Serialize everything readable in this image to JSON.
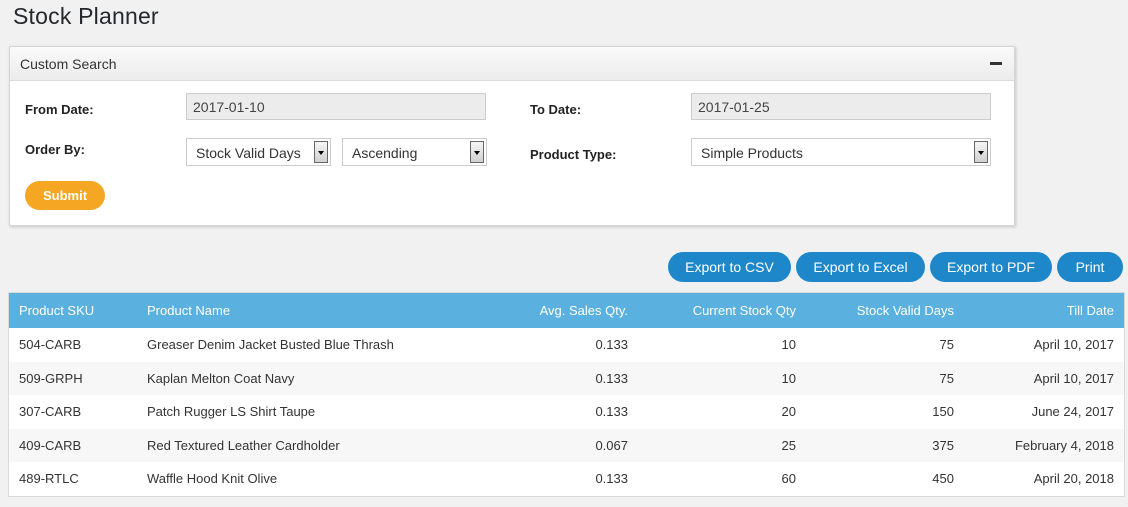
{
  "page": {
    "title": "Stock Planner"
  },
  "search": {
    "panel_title": "Custom Search",
    "from_date_label": "From Date:",
    "from_date_value": "2017-01-10",
    "to_date_label": "To Date:",
    "to_date_value": "2017-01-25",
    "order_by_label": "Order By:",
    "order_by_value": "Stock Valid Days",
    "order_direction_value": "Ascending",
    "product_type_label": "Product Type:",
    "product_type_value": "Simple Products",
    "submit_label": "Submit"
  },
  "actions": {
    "export_csv": "Export to CSV",
    "export_excel": "Export to Excel",
    "export_pdf": "Export to PDF",
    "print": "Print"
  },
  "table": {
    "headers": [
      "Product SKU",
      "Product Name",
      "Avg. Sales Qty.",
      "Current Stock Qty",
      "Stock Valid Days",
      "Till Date"
    ],
    "rows": [
      [
        "504-CARB",
        "Greaser Denim Jacket Busted Blue Thrash",
        "0.133",
        "10",
        "75",
        "April 10, 2017"
      ],
      [
        "509-GRPH",
        "Kaplan Melton Coat Navy",
        "0.133",
        "10",
        "75",
        "April 10, 2017"
      ],
      [
        "307-CARB",
        "Patch Rugger LS Shirt Taupe",
        "0.133",
        "20",
        "150",
        "June 24, 2017"
      ],
      [
        "409-CARB",
        "Red Textured Leather Cardholder",
        "0.067",
        "25",
        "375",
        "February 4, 2018"
      ],
      [
        "489-RTLC",
        "Waffle Hood Knit Olive",
        "0.133",
        "60",
        "450",
        "April 20, 2018"
      ]
    ]
  },
  "colors": {
    "submit": "#f5a623",
    "buttons": "#1e87c9",
    "table_header": "#5ab0de"
  },
  "icons": {
    "collapse": "minus-icon",
    "dropdown": "chevron-down-icon"
  }
}
